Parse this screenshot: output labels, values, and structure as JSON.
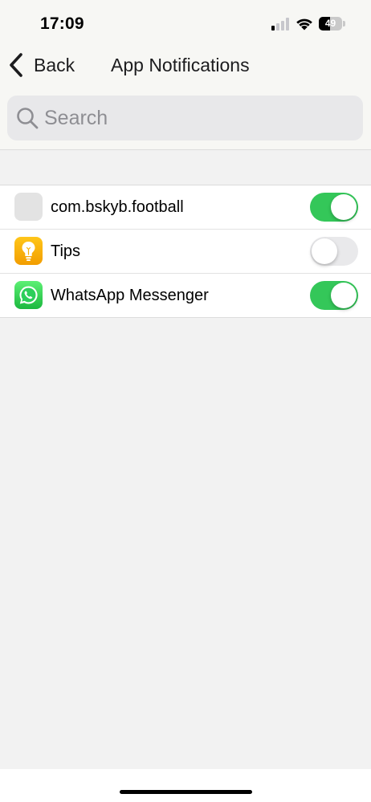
{
  "status_bar": {
    "time": "17:09",
    "battery_level": "49",
    "signal_bars_active": 1,
    "signal_bars_total": 4
  },
  "nav": {
    "back_label": "Back",
    "title": "App Notifications"
  },
  "search": {
    "placeholder": "Search",
    "value": ""
  },
  "apps": [
    {
      "name": "com.bskyb.football",
      "icon": "blank-app-icon",
      "enabled": true
    },
    {
      "name": "Tips",
      "icon": "tips-lightbulb-icon",
      "enabled": false
    },
    {
      "name": "WhatsApp Messenger",
      "icon": "whatsapp-icon",
      "enabled": true
    }
  ],
  "colors": {
    "toggle_on": "#34c759",
    "toggle_off": "#e9e9eb",
    "tips_icon": "#f5b000",
    "whatsapp_icon": "#25d366"
  }
}
